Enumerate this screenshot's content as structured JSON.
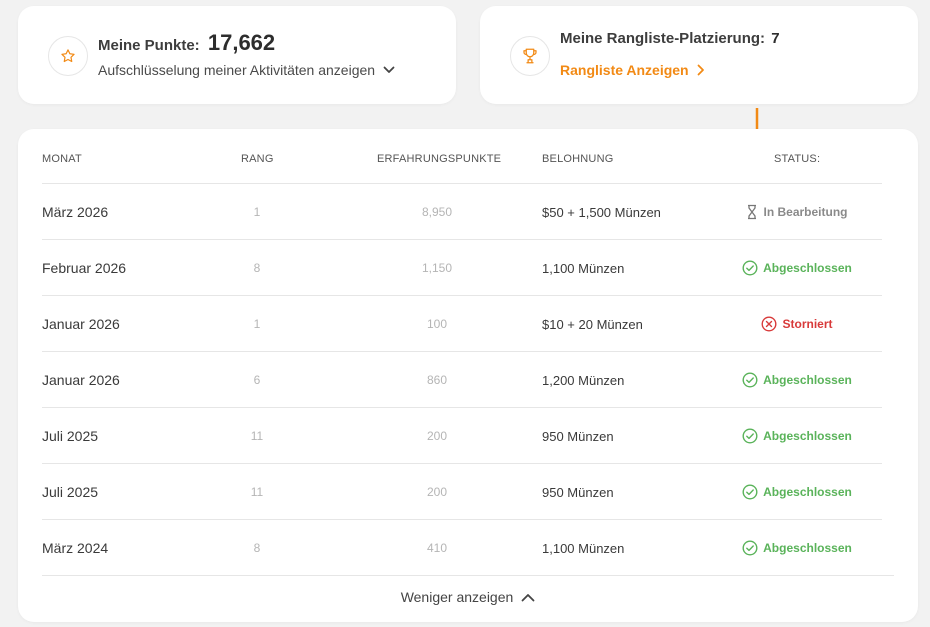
{
  "colors": {
    "accent": "#f28a15",
    "done": "#5ab35a",
    "cancel": "#d83a3a",
    "pending": "#8a8a8a"
  },
  "points_card": {
    "icon": "star-icon",
    "title_label": "Meine Punkte:",
    "points_value": "17,662",
    "details_link": "Aufschlüsselung meiner Aktivitäten anzeigen"
  },
  "rank_card": {
    "icon": "trophy-icon",
    "title_label": "Meine Rangliste-Platzierung:",
    "rank_value": "7",
    "link_label": "Rangliste Anzeigen"
  },
  "table": {
    "headers": [
      "MONAT",
      "RANG",
      "ERFAHRUNGSPUNKTE",
      "BELOHNUNG",
      "STATUS:"
    ],
    "rows": [
      {
        "month": "März 2026",
        "rank": "1",
        "xp": "8,950",
        "reward": "$50 + 1,500 Münzen",
        "status": "In Bearbeitung",
        "status_type": "pending"
      },
      {
        "month": "Februar 2026",
        "rank": "8",
        "xp": "1,150",
        "reward": "1,100 Münzen",
        "status": "Abgeschlossen",
        "status_type": "done"
      },
      {
        "month": "Januar 2026",
        "rank": "1",
        "xp": "100",
        "reward": "$10 + 20 Münzen",
        "status": "Storniert",
        "status_type": "cancel"
      },
      {
        "month": "Januar 2026",
        "rank": "6",
        "xp": "860",
        "reward": "1,200 Münzen",
        "status": "Abgeschlossen",
        "status_type": "done"
      },
      {
        "month": "Juli 2025",
        "rank": "11",
        "xp": "200",
        "reward": "950 Münzen",
        "status": "Abgeschlossen",
        "status_type": "done"
      },
      {
        "month": "Juli 2025",
        "rank": "11",
        "xp": "200",
        "reward": "950 Münzen",
        "status": "Abgeschlossen",
        "status_type": "done"
      },
      {
        "month": "März 2024",
        "rank": "8",
        "xp": "410",
        "reward": "1,100 Münzen",
        "status": "Abgeschlossen",
        "status_type": "done"
      }
    ],
    "show_less_label": "Weniger anzeigen"
  }
}
